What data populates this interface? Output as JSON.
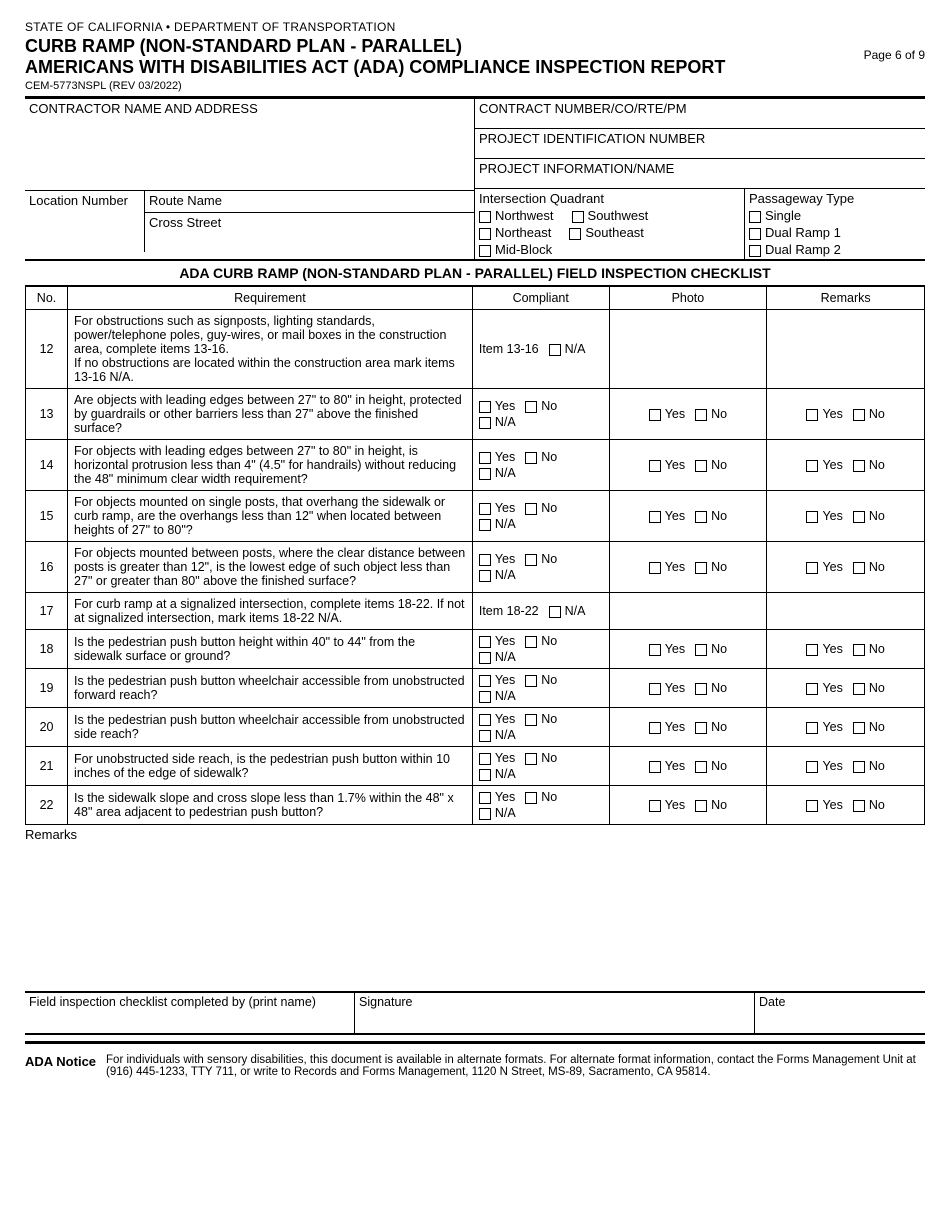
{
  "header": {
    "state_line": "STATE OF CALIFORNIA • DEPARTMENT OF TRANSPORTATION",
    "title_1": "CURB RAMP (NON-STANDARD PLAN - PARALLEL)",
    "title_2": "AMERICANS WITH DISABILITIES ACT (ADA) COMPLIANCE INSPECTION REPORT",
    "page": "Page 6 of 9",
    "form_code": "CEM-5773NSPL (REV 03/2022)"
  },
  "top": {
    "contractor_label": "CONTRACTOR NAME AND ADDRESS",
    "contract_num_label": "CONTRACT NUMBER/CO/RTE/PM",
    "project_id_label": "PROJECT IDENTIFICATION NUMBER",
    "project_info_label": "PROJECT INFORMATION/NAME",
    "location_label": "Location Number",
    "route_label": "Route Name",
    "cross_label": "Cross Street",
    "quadrant_label": "Intersection Quadrant",
    "quad_nw": "Northwest",
    "quad_sw": "Southwest",
    "quad_ne": "Northeast",
    "quad_se": "Southeast",
    "quad_mid": "Mid-Block",
    "passage_label": "Passageway Type",
    "pass_single": "Single",
    "pass_dual1": "Dual Ramp 1",
    "pass_dual2": "Dual Ramp 2"
  },
  "checklist_title": "ADA CURB RAMP (NON-STANDARD PLAN - PARALLEL) FIELD INSPECTION CHECKLIST",
  "columns": {
    "no": "No.",
    "req": "Requirement",
    "comp": "Compliant",
    "photo": "Photo",
    "rem": "Remarks"
  },
  "labels": {
    "yes": "Yes",
    "no": "No",
    "na": "N/A"
  },
  "rows": [
    {
      "no": "12",
      "req": "For obstructions such as signposts, lighting standards, power/telephone poles, guy-wires, or mail boxes in the construction area, complete items 13-16.\nIf no obstructions are located within the construction area mark items 13-16 N/A.",
      "type": "item",
      "item_label": "Item 13-16"
    },
    {
      "no": "13",
      "req": "Are objects with leading edges between 27\" to 80\" in height, protected by guardrails or other barriers less than 27\" above the finished surface?",
      "type": "std"
    },
    {
      "no": "14",
      "req": "For objects with leading edges between 27\" to 80\" in height, is horizontal protrusion less than 4\" (4.5\" for handrails) without reducing the 48\" minimum clear width requirement?",
      "type": "std"
    },
    {
      "no": "15",
      "req": "For objects mounted on single posts, that overhang the sidewalk or curb ramp, are the overhangs less than 12\" when located between heights of 27\" to 80\"?",
      "type": "std"
    },
    {
      "no": "16",
      "req": "For objects mounted between posts, where the clear distance between posts is greater than 12\", is the lowest edge of such object less than 27\" or greater than 80\" above the finished surface?",
      "type": "std"
    },
    {
      "no": "17",
      "req": "For curb ramp at a signalized intersection, complete items 18-22. If not at signalized intersection, mark items 18-22 N/A.",
      "type": "item",
      "item_label": "Item 18-22"
    },
    {
      "no": "18",
      "req": "Is the pedestrian push button height within 40\" to 44\" from the sidewalk surface or ground?",
      "type": "std"
    },
    {
      "no": "19",
      "req": "Is the pedestrian push button wheelchair accessible from unobstructed forward reach?",
      "type": "std"
    },
    {
      "no": "20",
      "req": "Is the pedestrian push button wheelchair accessible from unobstructed side reach?",
      "type": "std"
    },
    {
      "no": "21",
      "req": "For unobstructed side reach, is the pedestrian push button within 10 inches of the edge of sidewalk?",
      "type": "std"
    },
    {
      "no": "22",
      "req": "Is the sidewalk slope and cross slope less than 1.7% within the 48\" x 48\" area adjacent to pedestrian push button?",
      "type": "std"
    }
  ],
  "remarks_label": "Remarks",
  "sig": {
    "completed_by": "Field inspection checklist completed by (print name)",
    "signature": "Signature",
    "date": "Date"
  },
  "ada": {
    "label": "ADA Notice",
    "text": "For individuals with sensory disabilities, this document is available in alternate formats. For alternate format information, contact the Forms Management Unit at (916) 445-1233, TTY 711, or write to Records and Forms Management, 1120 N Street, MS-89, Sacramento, CA 95814."
  }
}
